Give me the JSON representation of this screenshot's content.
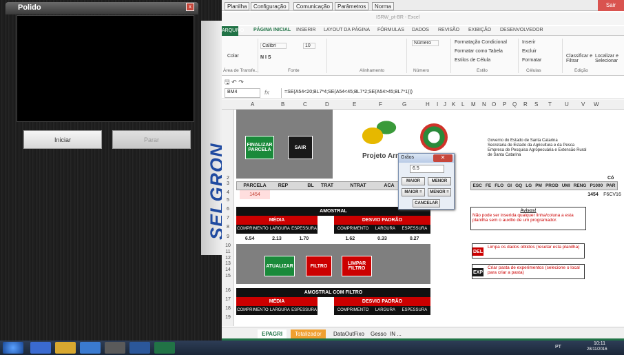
{
  "left_app": {
    "title": "Polido",
    "close": "x",
    "start_label": "Iniciar",
    "stop_label": "Parar",
    "brand": "SELGRON"
  },
  "excel": {
    "menu": [
      "Planilha",
      "Configuração",
      "Comunicação",
      "Parâmetros",
      "Norma"
    ],
    "sair": "Sair",
    "window_title": "ISRW_pt-BR - Excel",
    "ribbon_tabs": [
      "ARQUIVO",
      "PÁGINA INICIAL",
      "INSERIR",
      "LAYOUT DA PÁGINA",
      "FÓRMULAS",
      "DADOS",
      "REVISÃO",
      "EXIBIÇÃO",
      "DESENVOLVEDOR"
    ],
    "ribbon": {
      "colar": "Colar",
      "font": "Calibri",
      "size": "10",
      "numfmt": "Número",
      "cond": "Formatação Condicional",
      "table": "Formatar como Tabela",
      "styles": "Estilos de Célula",
      "insert": "Inserir",
      "delete": "Excluir",
      "format": "Formatar",
      "sort": "Classificar e Filtrar",
      "find": "Localizar e Selecionar",
      "groups": [
        "Área de Transfe...",
        "Fonte",
        "Alinhamento",
        "Número",
        "Estilo",
        "Células",
        "Edição"
      ]
    },
    "namebox": "BM4",
    "formula": "=SE(A54<20;BL7*4;SE(A54<45;BL7*2;SE(A54>45;BL7*1)))",
    "columns": [
      "A",
      "B",
      "C",
      "D",
      "E",
      "F",
      "G",
      "H",
      "I",
      "J",
      "K",
      "L",
      "M",
      "N",
      "O",
      "P",
      "Q",
      "R",
      "S",
      "T",
      "U",
      "V",
      "W"
    ],
    "rows": [
      "2",
      "3",
      "4",
      "5",
      "6",
      "7",
      "8",
      "9",
      "10",
      "11",
      "12",
      "13",
      "14",
      "15",
      "16",
      "17",
      "18",
      "19"
    ],
    "buttons": {
      "finalizar": "FINALIZAR PARCELA",
      "sair": "SAIR",
      "atualizar": "ATUALIZAR",
      "filtro": "FILTRO",
      "limpar": "LIMPAR FILTRO"
    },
    "gov_text": [
      "Governo do Estado de Santa Catarina",
      "Secretaria de Estado da Agricultura e da Pesca",
      "Empresa de Pesquisa Agropecuária e Extensão Rural",
      "de Santa Catarina"
    ],
    "projeto": "Projeto Arro",
    "headers_row3": [
      "PARCELA",
      "REP",
      "BL",
      "TRAT",
      "NTRAT",
      "ACA"
    ],
    "headers_row3_right": [
      "ESC",
      "FE",
      "FLO",
      "GI",
      "GQ",
      "LG",
      "PM",
      "PROD",
      "UMI",
      "RENG",
      "P1000",
      "PAR"
    ],
    "cod": "Có",
    "parcela_value": "1454",
    "par_value": "1454",
    "par_code": "F6CV16",
    "amostral": "AMOSTRAL",
    "media": "MÉDIA",
    "desvio": "DESVIO PADRÃO",
    "cols3": [
      "COMPRIMENTO",
      "LARGURA",
      "ESPESSURA"
    ],
    "media_vals": [
      "6.54",
      "2.13",
      "1.70"
    ],
    "desvio_vals": [
      "1.62",
      "0.33",
      "0.27"
    ],
    "amostral_filtro": "AMOSTRAL COM FILTRO",
    "avisos_title": "Avisos!",
    "avisos_text": "Não pode ser inserida qualquer linha/coluna a esta planilha sem o auxílio de um programador.",
    "del_label": "DEL",
    "del_text": "Limpa os dados obtidos (resetar esta planilha)",
    "exp_label": "EXP",
    "exp_text": "Criar pasta de experimentos (selecione o local para criar a pasta)",
    "sheet_tabs": [
      "EPAGRI",
      "Totalizador",
      "DataOutFixo",
      "Gesso",
      "IN ..."
    ]
  },
  "dialog": {
    "title": "Grãos",
    "value": "6.5",
    "maior": "MAIOR",
    "menor": "MENOR",
    "maior_eq": "MAIOR =",
    "menor_eq": "MENOR =",
    "cancelar": "CANCELAR"
  },
  "taskbar": {
    "time": "10:11",
    "date": "28/11/2016",
    "lang": "PT"
  }
}
